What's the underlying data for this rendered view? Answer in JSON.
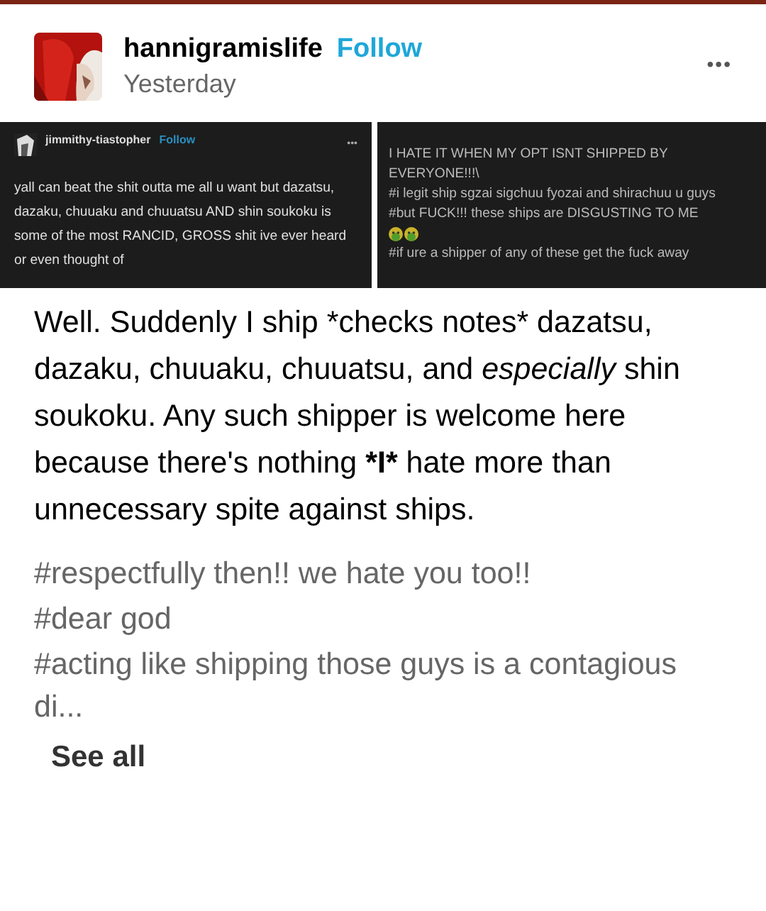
{
  "post": {
    "author": "hannigramislife",
    "follow": "Follow",
    "time": "Yesterday",
    "more": "•••"
  },
  "screenshots": [
    {
      "kind": "post",
      "author": "jimmithy-tiastopher",
      "follow": "Follow",
      "more": "•••",
      "body": "yall can beat the shit outta me all u want but dazatsu, dazaku, chuuaku and chuuatsu AND shin soukoku is some of the most RANCID, GROSS shit ive ever heard or even thought of"
    },
    {
      "kind": "tags",
      "tags": [
        {
          "kind": "text",
          "text": "I HATE IT WHEN MY OPT ISNT SHIPPED BY EVERYONE!!!\\"
        },
        {
          "kind": "text",
          "text": "#i legit ship sgzai sigchuu fyozai and shirachuu u guys"
        },
        {
          "kind": "text",
          "text": "#but FUCK!!! these ships are DISGUSTING TO ME"
        },
        {
          "kind": "emoji"
        },
        {
          "kind": "emoji"
        },
        {
          "kind": "text",
          "text": "#if ure a shipper of any of these get the fuck away"
        }
      ]
    }
  ],
  "body": [
    {
      "kind": "plain",
      "text": "Well. Suddenly I ship *checks notes* dazatsu, dazaku, chuuaku, chuuatsu, and "
    },
    {
      "kind": "italic",
      "text": "especially"
    },
    {
      "kind": "plain",
      "text": " shin soukoku. Any such shipper is welcome here because there's nothing "
    },
    {
      "kind": "bold",
      "text": "*I*"
    },
    {
      "kind": "plain",
      "text": " hate more than unnecessary spite against ships."
    }
  ],
  "tags": [
    "#respectfully then!! we hate you too!!",
    "#dear god",
    "#acting like shipping those guys is a contagious di..."
  ],
  "see_all": "See all"
}
